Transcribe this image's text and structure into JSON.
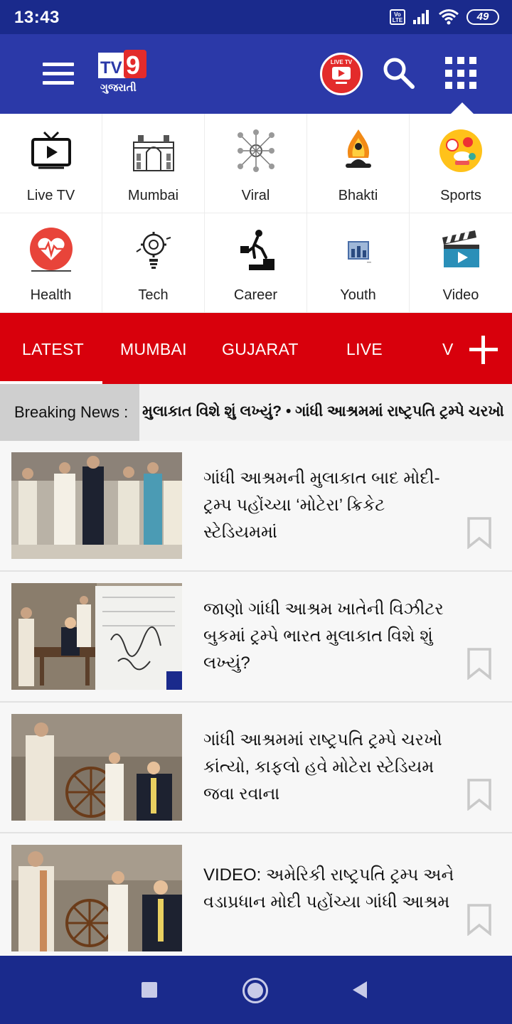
{
  "status_bar": {
    "time": "13:43",
    "network": "VoLTE",
    "battery": "49"
  },
  "header": {
    "logo_text": "TV9",
    "logo_sub": "ગુજરાતી",
    "livetv_badge": "LIVE TV"
  },
  "categories": [
    {
      "label": "Live TV",
      "icon": "tv-play-icon"
    },
    {
      "label": "Mumbai",
      "icon": "gateway-monument-icon"
    },
    {
      "label": "Viral",
      "icon": "network-icon"
    },
    {
      "label": "Bhakti",
      "icon": "meditation-icon"
    },
    {
      "label": "Sports",
      "icon": "sports-balls-icon"
    },
    {
      "label": "Health",
      "icon": "heart-pulse-icon"
    },
    {
      "label": "Tech",
      "icon": "gear-bulb-icon"
    },
    {
      "label": "Career",
      "icon": "career-steps-icon"
    },
    {
      "label": "Youth",
      "icon": "youth-image-icon"
    },
    {
      "label": "Video",
      "icon": "clapperboard-icon"
    }
  ],
  "tabs": [
    {
      "label": "LATEST",
      "active": true
    },
    {
      "label": "MUMBAI",
      "active": false
    },
    {
      "label": "GUJARAT",
      "active": false
    },
    {
      "label": "LIVE",
      "active": false
    },
    {
      "label": "V",
      "active": false
    }
  ],
  "breaking": {
    "label": "Breaking News :",
    "ticker": "મુલાકાત વિશે શું લખ્યું? • ગાંધી આશ્રમમાં રાષ્ટ્રપતિ ટ્રમ્પે ચરખો"
  },
  "news": [
    {
      "title": "ગાંધી આશ્રમની મુલાકાત બાદ મોદી-ટ્રમ્પ પહોંચ્યા ‘મોટેરા’ ક્રિકેટ સ્ટેડિયમમાં"
    },
    {
      "title": "જાણો ગાંધી આશ્રમ ખાતેની વિઝીટર બુકમાં ટ્રમ્પે ભારત મુલાકાત વિશે શું લખ્યું?"
    },
    {
      "title": "ગાંધી આશ્રમમાં રાષ્ટ્રપતિ ટ્રમ્પે ચરખો કાંત્યો, કાફલો હવે મોટેરા સ્ટેડિયમ જવા રવાના"
    },
    {
      "title": "VIDEO: અમેરિકી રાષ્ટ્રપતિ ટ્રમ્પ અને વડાપ્રધાન મોદી પહોંચ્યા ગાંધી આશ્રમ"
    }
  ],
  "colors": {
    "header": "#2b39a8",
    "status_bar": "#1a2a8c",
    "tab_bar": "#d8000c",
    "accent_red": "#e32b2b"
  }
}
